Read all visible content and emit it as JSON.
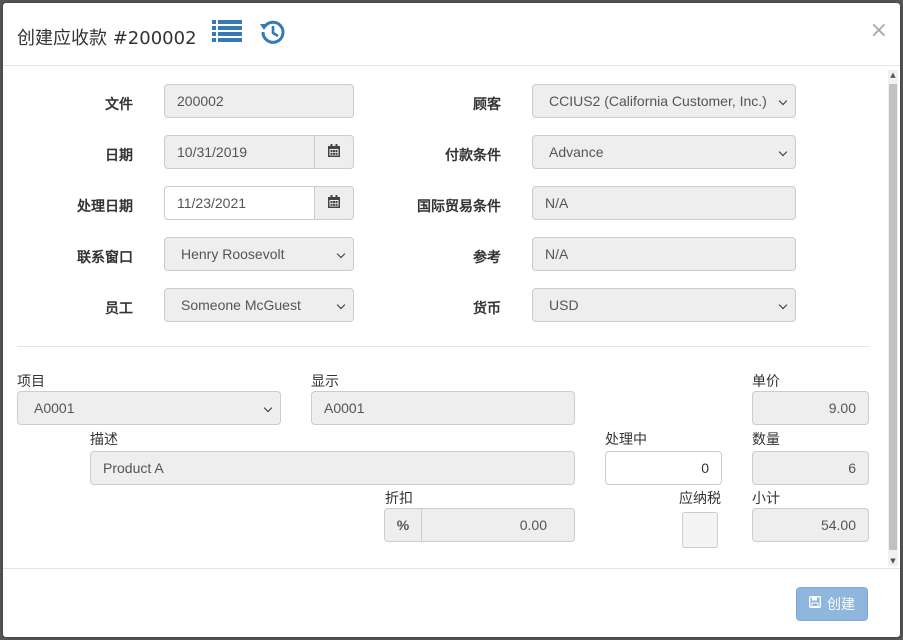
{
  "dialog": {
    "title": "创建应收款 #200002",
    "close_glyph": "×"
  },
  "header_icons": [
    "list-icon",
    "history-icon"
  ],
  "left_fields": {
    "document": {
      "label": "文件",
      "value": "200002"
    },
    "date": {
      "label": "日期",
      "value": "10/31/2019"
    },
    "process_date": {
      "label": "处理日期",
      "value": "11/23/2021"
    },
    "contact": {
      "label": "联系窗口",
      "value": "Henry Roosevolt"
    },
    "employee": {
      "label": "员工",
      "value": "Someone McGuest"
    }
  },
  "right_fields": {
    "customer": {
      "label": "顾客",
      "value": "CCIUS2 (California Customer, Inc.)"
    },
    "payment_terms": {
      "label": "付款条件",
      "value": "Advance"
    },
    "incoterms": {
      "label": "国际贸易条件",
      "value": "N/A"
    },
    "reference": {
      "label": "参考",
      "value": "N/A"
    },
    "currency": {
      "label": "货币",
      "value": "USD"
    }
  },
  "line_item": {
    "item": {
      "label": "项目",
      "value": "A0001"
    },
    "display": {
      "label": "显示",
      "value": "A0001"
    },
    "unit_price": {
      "label": "单价",
      "value": "9.00"
    },
    "description": {
      "label": "描述",
      "value": "Product A"
    },
    "processing": {
      "label": "处理中",
      "value": "0"
    },
    "quantity": {
      "label": "数量",
      "value": "6"
    },
    "discount": {
      "label": "折扣",
      "addon": "%",
      "value": "0.00"
    },
    "taxable": {
      "label": "应纳税",
      "checked": false
    },
    "subtotal": {
      "label": "小计",
      "value": "54.00"
    }
  },
  "footer": {
    "create_label": "创建"
  },
  "colors": {
    "create_button": "#8fb6dc",
    "icon_blue": "#337ab7"
  }
}
